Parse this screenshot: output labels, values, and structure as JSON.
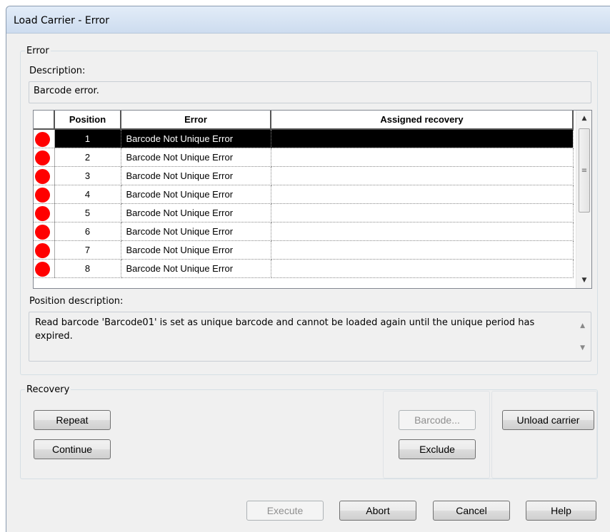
{
  "window": {
    "title": "Load Carrier - Error"
  },
  "error_group": {
    "legend": "Error",
    "description_label": "Description:",
    "description_value": "Barcode error.",
    "grid": {
      "columns": [
        "Position",
        "Error",
        "Assigned recovery"
      ],
      "rows": [
        {
          "status": "error",
          "position": "1",
          "error": "Barcode Not Unique Error",
          "recovery": "",
          "selected": true
        },
        {
          "status": "error",
          "position": "2",
          "error": "Barcode Not Unique Error",
          "recovery": ""
        },
        {
          "status": "error",
          "position": "3",
          "error": "Barcode Not Unique Error",
          "recovery": ""
        },
        {
          "status": "error",
          "position": "4",
          "error": "Barcode Not Unique Error",
          "recovery": ""
        },
        {
          "status": "error",
          "position": "5",
          "error": "Barcode Not Unique Error",
          "recovery": ""
        },
        {
          "status": "error",
          "position": "6",
          "error": "Barcode Not Unique Error",
          "recovery": ""
        },
        {
          "status": "error",
          "position": "7",
          "error": "Barcode Not Unique Error",
          "recovery": ""
        },
        {
          "status": "error",
          "position": "8",
          "error": "Barcode Not Unique Error",
          "recovery": ""
        }
      ],
      "status_color": "#ff0000"
    },
    "position_description_label": "Position description:",
    "position_description_value": "Read barcode 'Barcode01' is set as unique barcode and cannot be loaded again until the unique period has expired."
  },
  "recovery_group": {
    "legend": "Recovery",
    "repeat_label": "Repeat",
    "continue_label": "Continue",
    "barcode_label": "Barcode...",
    "exclude_label": "Exclude",
    "unload_label": "Unload carrier"
  },
  "footer": {
    "execute_label": "Execute",
    "abort_label": "Abort",
    "cancel_label": "Cancel",
    "help_label": "Help"
  }
}
